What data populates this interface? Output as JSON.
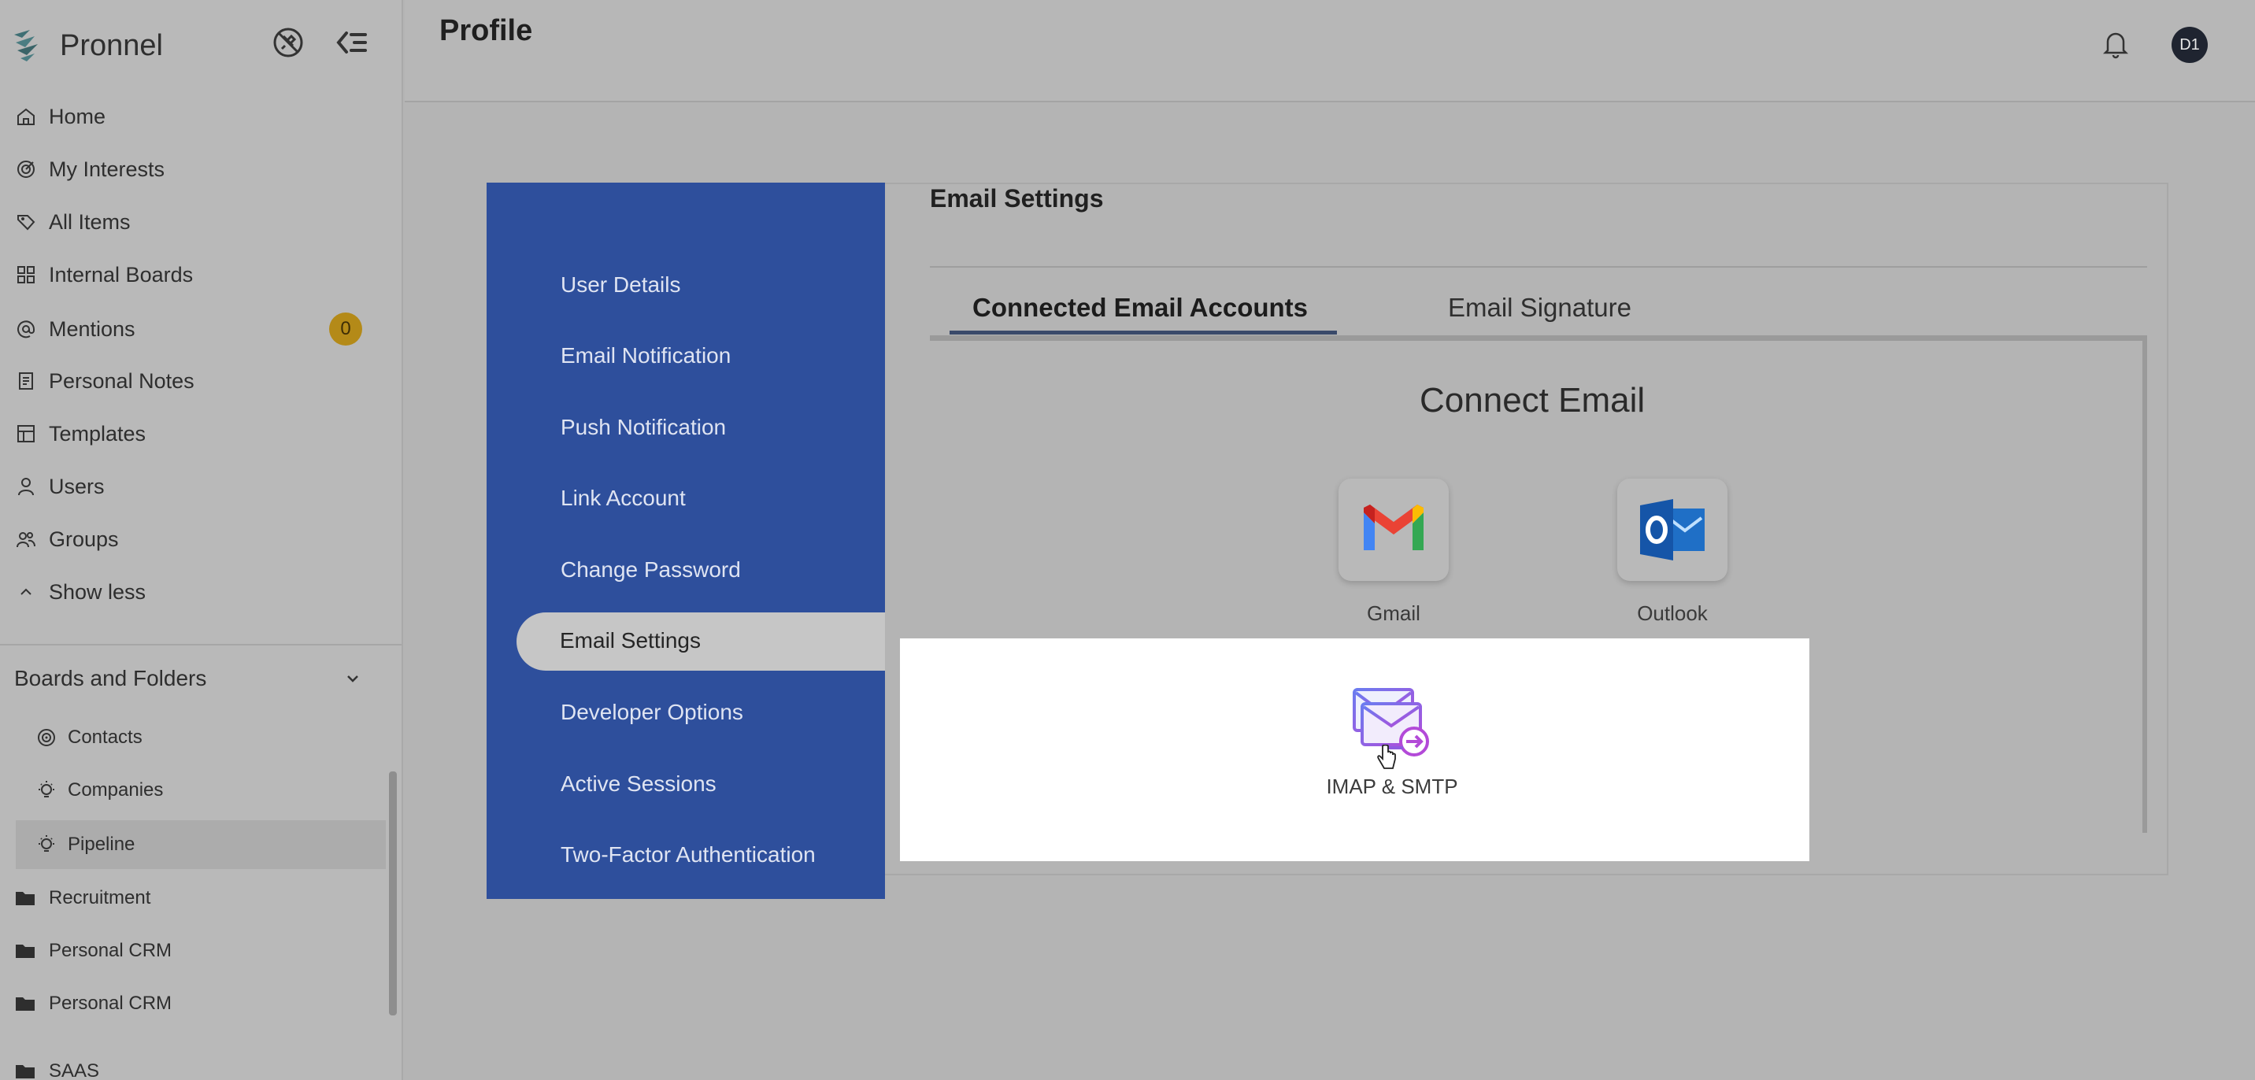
{
  "app": {
    "name": "Pronnel"
  },
  "sidebar": {
    "items": [
      {
        "label": "Home",
        "icon": "home-icon"
      },
      {
        "label": "My Interests",
        "icon": "target-icon"
      },
      {
        "label": "All Items",
        "icon": "tag-icon"
      },
      {
        "label": "Internal Boards",
        "icon": "grid-icon"
      },
      {
        "label": "Mentions",
        "icon": "at-icon",
        "badge": "0"
      },
      {
        "label": "Personal Notes",
        "icon": "note-icon"
      },
      {
        "label": "Templates",
        "icon": "template-icon"
      },
      {
        "label": "Users",
        "icon": "user-icon"
      },
      {
        "label": "Groups",
        "icon": "group-icon"
      },
      {
        "label": "Show less",
        "icon": "chevron-up-icon"
      }
    ],
    "section_title": "Boards and Folders",
    "boards": [
      {
        "label": "Contacts",
        "icon": "target-icon"
      },
      {
        "label": "Companies",
        "icon": "bulb-icon"
      },
      {
        "label": "Pipeline",
        "icon": "bulb-icon",
        "active": true
      }
    ],
    "folders": [
      {
        "label": "Recruitment"
      },
      {
        "label": "Personal CRM"
      },
      {
        "label": "Personal CRM"
      },
      {
        "label": "SAAS"
      }
    ]
  },
  "header": {
    "title": "Profile",
    "avatar": "D1"
  },
  "profile_menu": {
    "items": [
      {
        "label": "User Details"
      },
      {
        "label": "Email Notification"
      },
      {
        "label": "Push Notification"
      },
      {
        "label": "Link Account"
      },
      {
        "label": "Change Password"
      },
      {
        "label": "Email Settings"
      },
      {
        "label": "Developer Options"
      },
      {
        "label": "Active Sessions"
      },
      {
        "label": "Two-Factor Authentication"
      }
    ],
    "active": "Email Settings"
  },
  "email_settings": {
    "title": "Email Settings",
    "tabs": [
      {
        "label": "Connected Email Accounts"
      },
      {
        "label": "Email Signature"
      }
    ],
    "connect_title": "Connect Email",
    "providers": [
      {
        "label": "Gmail"
      },
      {
        "label": "Outlook"
      }
    ],
    "imap_label": "IMAP & SMTP"
  },
  "colors": {
    "menu_panel": "#2e4f9c",
    "badge": "#b48a18"
  }
}
